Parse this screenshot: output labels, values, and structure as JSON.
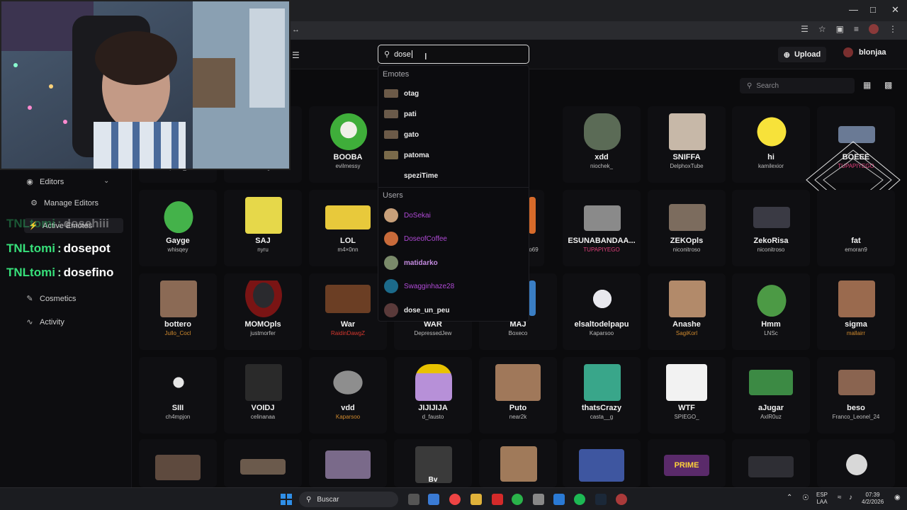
{
  "browser": {
    "window_controls": [
      "—",
      "□",
      "✕"
    ]
  },
  "header": {
    "search_value": "dose",
    "upload_label": "Upload",
    "username": "blonjaa"
  },
  "sidebar": {
    "items": [
      {
        "label": "Editors",
        "icon": "user-circle-icon"
      },
      {
        "label": "Manage Editors",
        "icon": "gear-icon"
      },
      {
        "label": "Active Emotes",
        "icon": "bolt-icon"
      },
      {
        "label": "Cosmetics",
        "icon": "brush-icon"
      },
      {
        "label": "Activity",
        "icon": "activity-icon"
      }
    ]
  },
  "chat": [
    {
      "nick": "TNLtomi",
      "sep": ":",
      "msg": "dosehiii"
    },
    {
      "nick": "TNLtomi",
      "sep": ":",
      "msg": "dosepot"
    },
    {
      "nick": "TNLtomi",
      "sep": ":",
      "msg": "dosefino"
    }
  ],
  "dropdown": {
    "emotes_header": "Emotes",
    "emotes": [
      "otag",
      "pati",
      "gato",
      "patoma",
      "speziTime"
    ],
    "users_header": "Users",
    "users": [
      {
        "name": "DoSekai",
        "color": "#b04ad6"
      },
      {
        "name": "DoseofCoffee",
        "color": "#b04ad6"
      },
      {
        "name": "matidarko",
        "color": "#c48be0"
      },
      {
        "name": "Swagginhaze28",
        "color": "#b04ad6"
      },
      {
        "name": "dose_un_peu",
        "color": "#ececec"
      }
    ]
  },
  "gallery": {
    "search_placeholder": "Search",
    "row0": [
      {
        "name": "",
        "owner": "pacal_"
      },
      {
        "name": "",
        "owner": "JustRogan"
      },
      {
        "name": "BOOBA",
        "owner": "evilmessy"
      },
      {
        "name": "xdd",
        "owner": "niochek_"
      },
      {
        "name": "SNIFFA",
        "owner": "DelphoxTube"
      },
      {
        "name": "hi",
        "owner": "kamilexior"
      },
      {
        "name": "BOEEE",
        "owner": "TUPAPIYEGO"
      }
    ],
    "row1": [
      {
        "name": "Gayge",
        "owner": "whisqey"
      },
      {
        "name": "SAJ",
        "owner": "nyru"
      },
      {
        "name": "LOL",
        "owner": "m4×0nn"
      },
      {
        "name": "",
        "owner": "ito69"
      },
      {
        "name": "ESUNABANDAA...",
        "owner": "TUPAPIYEGO"
      },
      {
        "name": "ZEKOpls",
        "owner": "niconitroso"
      },
      {
        "name": "ZekoRisa",
        "owner": "niconitroso"
      },
      {
        "name": "fat",
        "owner": "emoran9"
      }
    ],
    "row2": [
      {
        "name": "bottero",
        "owner": "Jullo_Cocl"
      },
      {
        "name": "MOMOpls",
        "owner": "justmorfer"
      },
      {
        "name": "War",
        "owner": "RaidinDawgZ"
      },
      {
        "name": "WAR",
        "owner": "DepressedJew"
      },
      {
        "name": "MAJ",
        "owner": "Boxeco"
      },
      {
        "name": "elsaltodelpapu",
        "owner": "Kaparsoo"
      },
      {
        "name": "Anashe",
        "owner": "SagiKorl"
      },
      {
        "name": "Hmm",
        "owner": "LNSc"
      },
      {
        "name": "sigma",
        "owner": "mallairr"
      }
    ],
    "row3": [
      {
        "name": "SIII",
        "owner": "ch4mpjon"
      },
      {
        "name": "VOIDJ",
        "owner": "celinanaa"
      },
      {
        "name": "vdd",
        "owner": "Kaparsoo"
      },
      {
        "name": "JIJIJIJA",
        "owner": "d_fausto"
      },
      {
        "name": "Puto",
        "owner": "near2k"
      },
      {
        "name": "thatsCrazy",
        "owner": "casta__g"
      },
      {
        "name": "WTF",
        "owner": "SPIEGO_"
      },
      {
        "name": "aJugar",
        "owner": "AxlR0uz"
      },
      {
        "name": "beso",
        "owner": "Franco_Leonel_24"
      }
    ],
    "row4_labels": [
      "Bv",
      "PRIME"
    ]
  },
  "taskbar": {
    "search_label": "Buscar",
    "lang_top": "ESP",
    "lang_bottom": "LAA",
    "time": "07:39",
    "date": "4/2/2026"
  }
}
